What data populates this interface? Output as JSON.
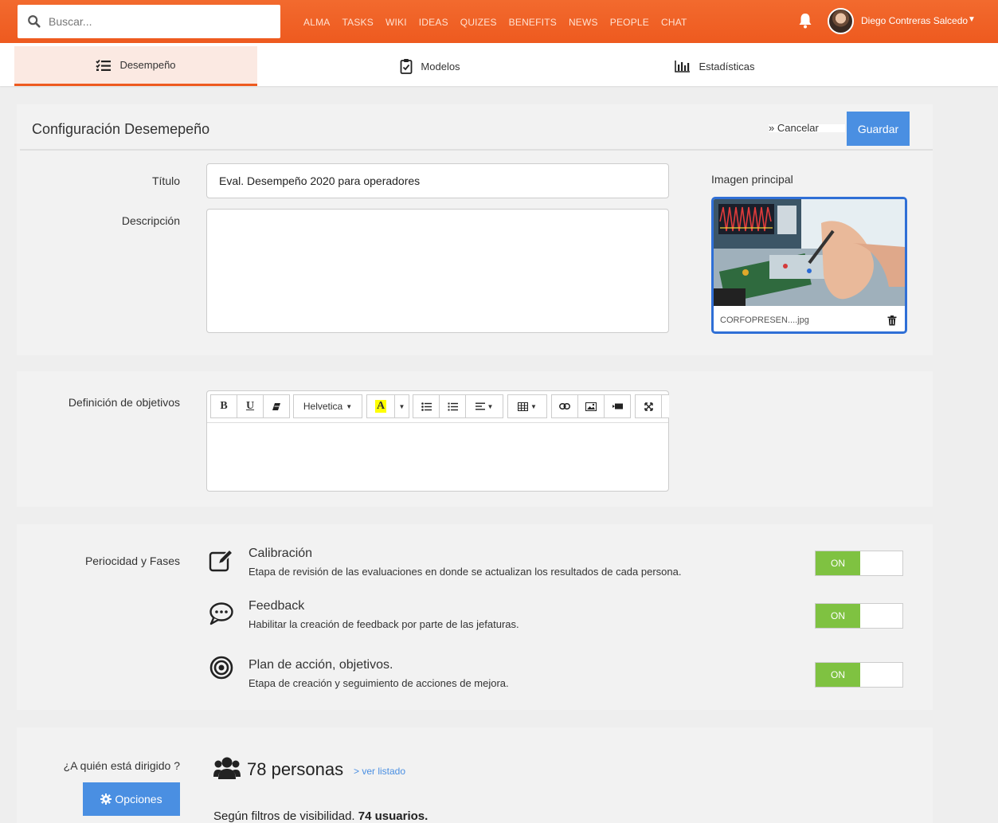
{
  "search": {
    "placeholder": "Buscar..."
  },
  "nav": [
    "ALMA",
    "TASKS",
    "WIKI",
    "IDEAS",
    "QUIZES",
    "BENEFITS",
    "NEWS",
    "PEOPLE",
    "CHAT"
  ],
  "user": {
    "name": "Diego Contreras Salcedo",
    "caret": "▼"
  },
  "tabs": [
    {
      "label": "Desempeño",
      "icon": "list-check-icon",
      "active": true
    },
    {
      "label": "Modelos",
      "icon": "clipboard-check-icon",
      "active": false
    },
    {
      "label": "Estadísticas",
      "icon": "bar-chart-icon",
      "active": false
    }
  ],
  "config": {
    "title": "Configuración Desemepeño",
    "cancel": "» Cancelar",
    "save": "Guardar",
    "titulo_label": "Título",
    "titulo_value": "Eval. Desempeño 2020 para operadores",
    "descripcion_label": "Descripción",
    "descripcion_value": "",
    "imagen_label": "Imagen principal",
    "imagen_file": "CORFOPRESEN....jpg"
  },
  "objetivos": {
    "label": "Definición de objetivos",
    "font": "Helvetica",
    "toolbar": [
      "bold-icon",
      "underline-icon",
      "eraser-icon",
      "font-select",
      "highlight-icon",
      "dropdown-icon",
      "bullet-list-icon",
      "numbered-list-icon",
      "align-icon",
      "table-icon",
      "link-icon",
      "image-icon",
      "video-icon",
      "fullscreen-icon"
    ],
    "bold": "B",
    "underline": "U",
    "highlight": "A"
  },
  "fases": {
    "label": "Periocidad y Fases",
    "items": [
      {
        "title": "Calibración",
        "desc": "Etapa de revisión de las evaluaciones en donde se actualizan los resultados  de cada persona.",
        "toggle": "ON",
        "icon": "edit-icon"
      },
      {
        "title": "Feedback",
        "desc": "Habilitar la creación de feedback por parte de las jefaturas.",
        "toggle": "ON",
        "icon": "chat-bubble-icon"
      },
      {
        "title": "Plan de acción, objetivos.",
        "desc": "Etapa de creación y seguimiento de acciones de mejora.",
        "toggle": "ON",
        "icon": "target-icon"
      }
    ]
  },
  "audiencia": {
    "label": "¿A quién está dirigido ?",
    "count": "78 personas",
    "ver": "> ver listado",
    "options": "Opciones",
    "vis_prefix": "Según filtros de visibilidad. ",
    "vis_bold": "74 usuarios."
  },
  "colors": {
    "accent": "#ee5a1f",
    "primary": "#4a8fe2",
    "toggle_on": "#7fc241"
  }
}
